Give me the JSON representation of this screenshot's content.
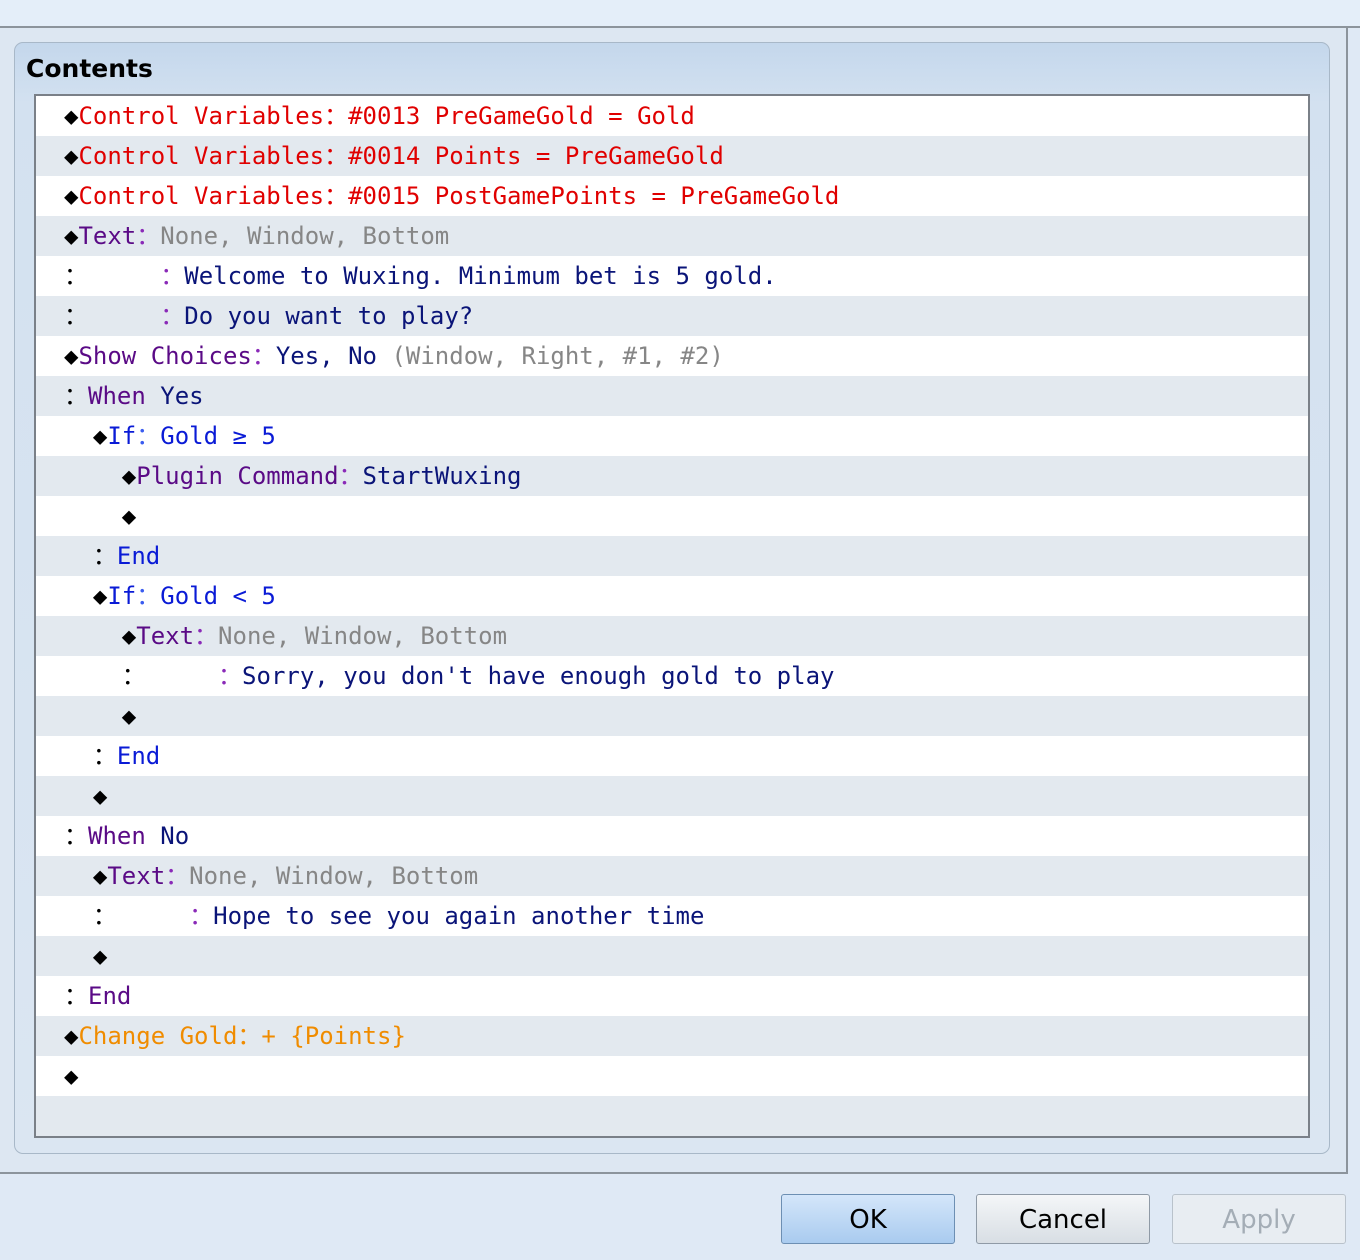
{
  "group": {
    "title": "Contents"
  },
  "buttons": {
    "ok": "OK",
    "cancel": "Cancel",
    "apply": "Apply"
  },
  "event_lines": [
    [
      [
        "◆",
        "glyph"
      ],
      [
        "Control Variables",
        "cmd-red"
      ],
      [
        "：",
        "sep-red"
      ],
      [
        "#0013 PreGameGold = Gold",
        "cmd-red"
      ]
    ],
    [
      [
        "◆",
        "glyph"
      ],
      [
        "Control Variables",
        "cmd-red"
      ],
      [
        "：",
        "sep-red"
      ],
      [
        "#0014 Points = PreGameGold",
        "cmd-red"
      ]
    ],
    [
      [
        "◆",
        "glyph"
      ],
      [
        "Control Variables",
        "cmd-red"
      ],
      [
        "：",
        "sep-red"
      ],
      [
        "#0015 PostGamePoints = PreGameGold",
        "cmd-red"
      ]
    ],
    [
      [
        "◆",
        "glyph"
      ],
      [
        "Text",
        "cmd-purple"
      ],
      [
        "：",
        "sep-purple"
      ],
      [
        "None, Window, Bottom",
        "txt-gray"
      ]
    ],
    [
      [
        "：",
        "glyph"
      ],
      [
        "     ",
        "glyph"
      ],
      [
        "：",
        "sep-purple"
      ],
      [
        "Welcome to Wuxing. Minimum bet is 5 gold.",
        "txt-navy"
      ]
    ],
    [
      [
        "：",
        "glyph"
      ],
      [
        "     ",
        "glyph"
      ],
      [
        "：",
        "sep-purple"
      ],
      [
        "Do you want to play?",
        "txt-navy"
      ]
    ],
    [
      [
        "◆",
        "glyph"
      ],
      [
        "Show Choices",
        "cmd-purple"
      ],
      [
        "：",
        "sep-purple"
      ],
      [
        "Yes, No",
        "txt-navy"
      ],
      [
        " (Window, Right, #1, #2)",
        "txt-gray"
      ]
    ],
    [
      [
        "：",
        "glyph"
      ],
      [
        "When",
        "cmd-purple"
      ],
      [
        " Yes",
        "txt-navy"
      ]
    ],
    [
      [
        "  ◆",
        "glyph"
      ],
      [
        "If",
        "cmd-blue"
      ],
      [
        "：",
        "sep-blue"
      ],
      [
        "Gold ≥ 5",
        "cmd-blue"
      ]
    ],
    [
      [
        "    ◆",
        "glyph"
      ],
      [
        "Plugin Command",
        "cmd-purple"
      ],
      [
        "：",
        "sep-purple"
      ],
      [
        "StartWuxing",
        "txt-navy"
      ]
    ],
    [
      [
        "    ◆",
        "glyph"
      ]
    ],
    [
      [
        "  ：",
        "glyph"
      ],
      [
        "End",
        "cmd-blue"
      ]
    ],
    [
      [
        "  ◆",
        "glyph"
      ],
      [
        "If",
        "cmd-blue"
      ],
      [
        "：",
        "sep-blue"
      ],
      [
        "Gold < 5",
        "cmd-blue"
      ]
    ],
    [
      [
        "    ◆",
        "glyph"
      ],
      [
        "Text",
        "cmd-purple"
      ],
      [
        "：",
        "sep-purple"
      ],
      [
        "None, Window, Bottom",
        "txt-gray"
      ]
    ],
    [
      [
        "    ：",
        "glyph"
      ],
      [
        "     ",
        "glyph"
      ],
      [
        "：",
        "sep-purple"
      ],
      [
        "Sorry, you don't have enough gold to play",
        "txt-navy"
      ]
    ],
    [
      [
        "    ◆",
        "glyph"
      ]
    ],
    [
      [
        "  ：",
        "glyph"
      ],
      [
        "End",
        "cmd-blue"
      ]
    ],
    [
      [
        "  ◆",
        "glyph"
      ]
    ],
    [
      [
        "：",
        "glyph"
      ],
      [
        "When",
        "cmd-purple"
      ],
      [
        " No",
        "txt-navy"
      ]
    ],
    [
      [
        "  ◆",
        "glyph"
      ],
      [
        "Text",
        "cmd-purple"
      ],
      [
        "：",
        "sep-purple"
      ],
      [
        "None, Window, Bottom",
        "txt-gray"
      ]
    ],
    [
      [
        "  ：",
        "glyph"
      ],
      [
        "     ",
        "glyph"
      ],
      [
        "：",
        "sep-purple"
      ],
      [
        "Hope to see you again another time",
        "txt-navy"
      ]
    ],
    [
      [
        "  ◆",
        "glyph"
      ]
    ],
    [
      [
        "：",
        "glyph"
      ],
      [
        "End",
        "cmd-purple"
      ]
    ],
    [
      [
        "◆",
        "glyph"
      ],
      [
        "Change Gold",
        "cmd-orange"
      ],
      [
        "：",
        "sep-orange"
      ],
      [
        "+ {Points}",
        "cmd-orange"
      ]
    ],
    [
      [
        "◆",
        "glyph"
      ]
    ]
  ]
}
